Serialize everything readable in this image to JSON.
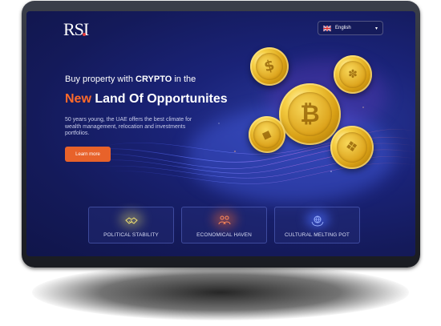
{
  "header": {
    "logo_text": "RSI",
    "language": {
      "label": "English",
      "flag": "uk-flag-icon"
    }
  },
  "hero": {
    "headline_prefix": "Buy property with ",
    "headline_emphasis": "CRYPTO",
    "headline_suffix": " in the",
    "subheadline_accent": "New",
    "subheadline_rest": " Land Of Opportunites",
    "description": "50 years young, the UAE offers the best climate for wealth management, relocation and investments portfolios.",
    "cta_label": "Learn more"
  },
  "features": [
    {
      "label": "POLITICAL STABILITY",
      "icon": "handshake-icon",
      "glow": "#e8e06a"
    },
    {
      "label": "ECONOMICAL HAVEN",
      "icon": "people-coins-icon",
      "glow": "#ff6a2a"
    },
    {
      "label": "CULTURAL MELTING POT",
      "icon": "globe-hands-icon",
      "glow": "#4a6cff"
    }
  ],
  "coins": [
    "bitcoin-coin-icon",
    "cardano-coin-icon",
    "dollar-coin-icon",
    "ethereum-coin-icon",
    "binance-coin-icon"
  ],
  "colors": {
    "accent": "#ff6a2a",
    "cta": "#e8622a",
    "background": "#141a5a"
  }
}
